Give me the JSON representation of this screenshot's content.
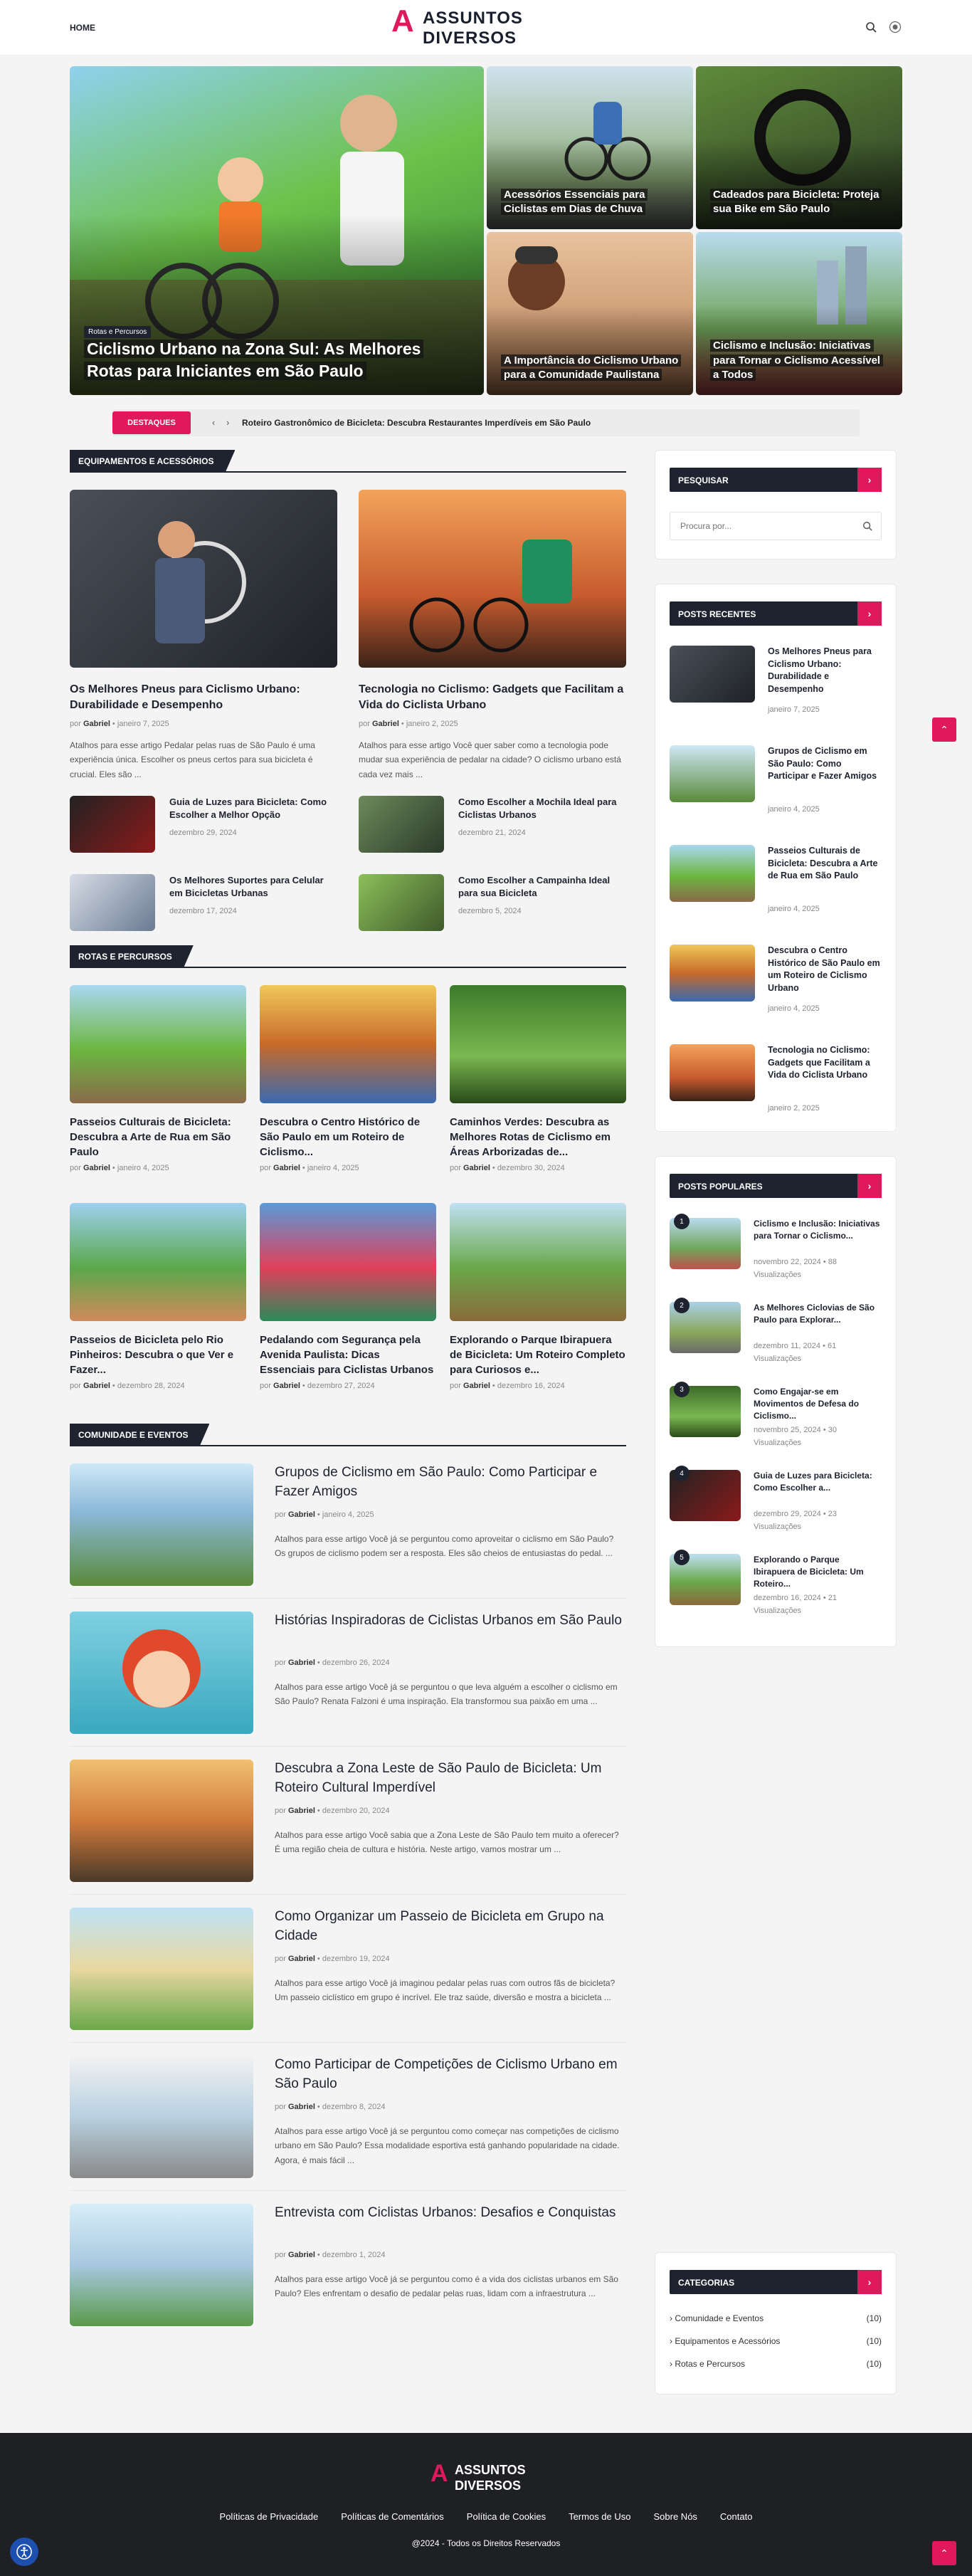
{
  "header": {
    "home": "HOME",
    "logo_top": "ASSUNTOS",
    "logo_bottom": "DIVERSOS"
  },
  "hero": {
    "big": {
      "category": "Rotas e Percursos",
      "title": "Ciclismo Urbano na Zona Sul: As Melhores Rotas para Iniciantes em São Paulo"
    },
    "small": [
      {
        "title": "Acessórios Essenciais para Ciclistas em Dias de Chuva"
      },
      {
        "title": "Cadeados para Bicicleta: Proteja sua Bike em São Paulo"
      },
      {
        "title": "A Importância do Ciclismo Urbano para a Comunidade Paulistana"
      },
      {
        "title": "Ciclismo e Inclusão: Iniciativas para Tornar o Ciclismo Acessível a Todos"
      }
    ]
  },
  "ticker": {
    "label": "DESTAQUES",
    "text": "Roteiro Gastronômico de Bicicleta: Descubra Restaurantes Imperdíveis em São Paulo"
  },
  "equip": {
    "title": "EQUIPAMENTOS E ACESSÓRIOS",
    "featured": [
      {
        "title": "Os Melhores Pneus para Ciclismo Urbano: Durabilidade e Desempenho",
        "by": "por",
        "author": "Gabriel",
        "date": "janeiro 7, 2025",
        "excerpt": "Atalhos para esse artigo Pedalar pelas ruas de São Paulo é uma experiência única. Escolher os pneus certos para sua bicicleta é crucial. Eles são ..."
      },
      {
        "title": "Tecnologia no Ciclismo: Gadgets que Facilitam a Vida do Ciclista Urbano",
        "by": "por",
        "author": "Gabriel",
        "date": "janeiro 2, 2025",
        "excerpt": "Atalhos para esse artigo Você quer saber como a tecnologia pode mudar sua experiência de pedalar na cidade? O ciclismo urbano está cada vez mais ..."
      }
    ],
    "small": [
      {
        "title": "Guia de Luzes para Bicicleta: Como Escolher a Melhor Opção",
        "date": "dezembro 29, 2024"
      },
      {
        "title": "Como Escolher a Mochila Ideal para Ciclistas Urbanos",
        "date": "dezembro 21, 2024"
      },
      {
        "title": "Os Melhores Suportes para Celular em Bicicletas Urbanas",
        "date": "dezembro 17, 2024"
      },
      {
        "title": "Como Escolher a Campainha Ideal para sua Bicicleta",
        "date": "dezembro 5, 2024"
      }
    ]
  },
  "rotas": {
    "title": "ROTAS E PERCURSOS",
    "items": [
      {
        "title": "Passeios Culturais de Bicicleta: Descubra a Arte de Rua em São Paulo",
        "by": "por",
        "author": "Gabriel",
        "date": "janeiro 4, 2025"
      },
      {
        "title": "Descubra o Centro Histórico de São Paulo em um Roteiro de Ciclismo...",
        "by": "por",
        "author": "Gabriel",
        "date": "janeiro 4, 2025"
      },
      {
        "title": "Caminhos Verdes: Descubra as Melhores Rotas de Ciclismo em Áreas Arborizadas de...",
        "by": "por",
        "author": "Gabriel",
        "date": "dezembro 30, 2024"
      },
      {
        "title": "Passeios de Bicicleta pelo Rio Pinheiros: Descubra o que Ver e Fazer...",
        "by": "por",
        "author": "Gabriel",
        "date": "dezembro 28, 2024"
      },
      {
        "title": "Pedalando com Segurança pela Avenida Paulista: Dicas Essenciais para Ciclistas Urbanos",
        "by": "por",
        "author": "Gabriel",
        "date": "dezembro 27, 2024"
      },
      {
        "title": "Explorando o Parque Ibirapuera de Bicicleta: Um Roteiro Completo para Curiosos e...",
        "by": "por",
        "author": "Gabriel",
        "date": "dezembro 16, 2024"
      }
    ]
  },
  "comunidade": {
    "title": "COMUNIDADE E EVENTOS",
    "items": [
      {
        "title": "Grupos de Ciclismo em São Paulo: Como Participar e Fazer Amigos",
        "by": "por",
        "author": "Gabriel",
        "date": "janeiro 4, 2025",
        "excerpt": "Atalhos para esse artigo Você já se perguntou como aproveitar o ciclismo em São Paulo? Os grupos de ciclismo podem ser a resposta. Eles são cheios de entusiastas do pedal. ..."
      },
      {
        "title": "Histórias Inspiradoras de Ciclistas Urbanos em São Paulo",
        "by": "por",
        "author": "Gabriel",
        "date": "dezembro 26, 2024",
        "excerpt": "Atalhos para esse artigo Você já se perguntou o que leva alguém a escolher o ciclismo em São Paulo? Renata Falzoni é uma inspiração. Ela transformou sua paixão em uma ..."
      },
      {
        "title": "Descubra a Zona Leste de São Paulo de Bicicleta: Um Roteiro Cultural Imperdível",
        "by": "por",
        "author": "Gabriel",
        "date": "dezembro 20, 2024",
        "excerpt": "Atalhos para esse artigo Você sabia que a Zona Leste de São Paulo tem muito a oferecer? É uma região cheia de cultura e história. Neste artigo, vamos mostrar um ..."
      },
      {
        "title": "Como Organizar um Passeio de Bicicleta em Grupo na Cidade",
        "by": "por",
        "author": "Gabriel",
        "date": "dezembro 19, 2024",
        "excerpt": "Atalhos para esse artigo Você já imaginou pedalar pelas ruas com outros fãs de bicicleta? Um passeio ciclístico em grupo é incrível. Ele traz saúde, diversão e mostra a bicicleta ..."
      },
      {
        "title": "Como Participar de Competições de Ciclismo Urbano em São Paulo",
        "by": "por",
        "author": "Gabriel",
        "date": "dezembro 8, 2024",
        "excerpt": "Atalhos para esse artigo Você já se perguntou como começar nas competições de ciclismo urbano em São Paulo? Essa modalidade esportiva está ganhando popularidade na cidade. Agora, é mais fácil ..."
      },
      {
        "title": "Entrevista com Ciclistas Urbanos: Desafios e Conquistas",
        "by": "por",
        "author": "Gabriel",
        "date": "dezembro 1, 2024",
        "excerpt": "Atalhos para esse artigo Você já se perguntou como é a vida dos ciclistas urbanos em São Paulo? Eles enfrentam o desafio de pedalar pelas ruas, lidam com a infraestrutura ..."
      }
    ]
  },
  "sidebar": {
    "search_title": "PESQUISAR",
    "search_placeholder": "Procura por...",
    "recent_title": "POSTS RECENTES",
    "recent": [
      {
        "title": "Os Melhores Pneus para Ciclismo Urbano: Durabilidade e Desempenho",
        "date": "janeiro 7, 2025"
      },
      {
        "title": "Grupos de Ciclismo em São Paulo: Como Participar e Fazer Amigos",
        "date": "janeiro 4, 2025"
      },
      {
        "title": "Passeios Culturais de Bicicleta: Descubra a Arte de Rua em São Paulo",
        "date": "janeiro 4, 2025"
      },
      {
        "title": "Descubra o Centro Histórico de São Paulo em um Roteiro de Ciclismo Urbano",
        "date": "janeiro 4, 2025"
      },
      {
        "title": "Tecnologia no Ciclismo: Gadgets que Facilitam a Vida do Ciclista Urbano",
        "date": "janeiro 2, 2025"
      }
    ],
    "popular_title": "POSTS POPULARES",
    "popular": [
      {
        "num": "1",
        "title": "Ciclismo e Inclusão: Iniciativas para Tornar o Ciclismo...",
        "date": "novembro 22, 2024",
        "views": "88",
        "views_label": "Visualizações"
      },
      {
        "num": "2",
        "title": "As Melhores Ciclovias de São Paulo para Explorar...",
        "date": "dezembro 11, 2024",
        "views": "61",
        "views_label": "Visualizações"
      },
      {
        "num": "3",
        "title": "Como Engajar-se em Movimentos de Defesa do Ciclismo...",
        "date": "novembro 25, 2024",
        "views": "30",
        "views_label": "Visualizações"
      },
      {
        "num": "4",
        "title": "Guia de Luzes para Bicicleta: Como Escolher a...",
        "date": "dezembro 29, 2024",
        "views": "23",
        "views_label": "Visualizações"
      },
      {
        "num": "5",
        "title": "Explorando o Parque Ibirapuera de Bicicleta: Um Roteiro...",
        "date": "dezembro 16, 2024",
        "views": "21",
        "views_label": "Visualizações"
      }
    ],
    "cat_title": "CATEGORIAS",
    "categories": [
      {
        "name": "Comunidade e Eventos",
        "count": "(10)"
      },
      {
        "name": "Equipamentos e Acessórios",
        "count": "(10)"
      },
      {
        "name": "Rotas e Percursos",
        "count": "(10)"
      }
    ]
  },
  "footer": {
    "logo_top": "ASSUNTOS",
    "logo_bottom": "DIVERSOS",
    "links": [
      "Políticas de Privacidade",
      "Políticas de Comentários",
      "Política de Cookies",
      "Termos de Uso",
      "Sobre Nós",
      "Contato"
    ],
    "copyright": "@2024 - Todos os Direitos Reservados"
  },
  "colors": {
    "accent": "#e0185c",
    "dark": "#1f2330"
  }
}
